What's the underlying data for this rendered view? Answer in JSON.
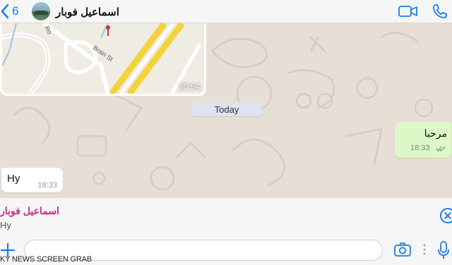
{
  "header": {
    "back_count": "6",
    "contact_name": "اسماعيل فوبار",
    "icons": {
      "back": "chevron-left-icon",
      "video": "video-call-icon",
      "phone": "phone-icon"
    },
    "accent_color": "#1a7ee6"
  },
  "map_message": {
    "street_label": "Brain St",
    "partial_label": "Ro",
    "time": "20:54"
  },
  "date_divider": "Today",
  "outgoing_message": {
    "text": "مرحبا",
    "time": "18:33",
    "status_icon": "double-check-icon"
  },
  "incoming_message": {
    "text": "Hy",
    "time": "18:33"
  },
  "reply_preview": {
    "sender": "اسماعيل فوبار",
    "text": "Hy",
    "sender_color": "#c0308a",
    "close_icon": "close-circle-icon"
  },
  "input_bar": {
    "value": "",
    "icons": {
      "add": "plus-icon",
      "camera": "camera-icon",
      "more": "dots-icon",
      "mic": "microphone-icon"
    }
  },
  "watermark": "KY NEWS SCREEN GRAB"
}
